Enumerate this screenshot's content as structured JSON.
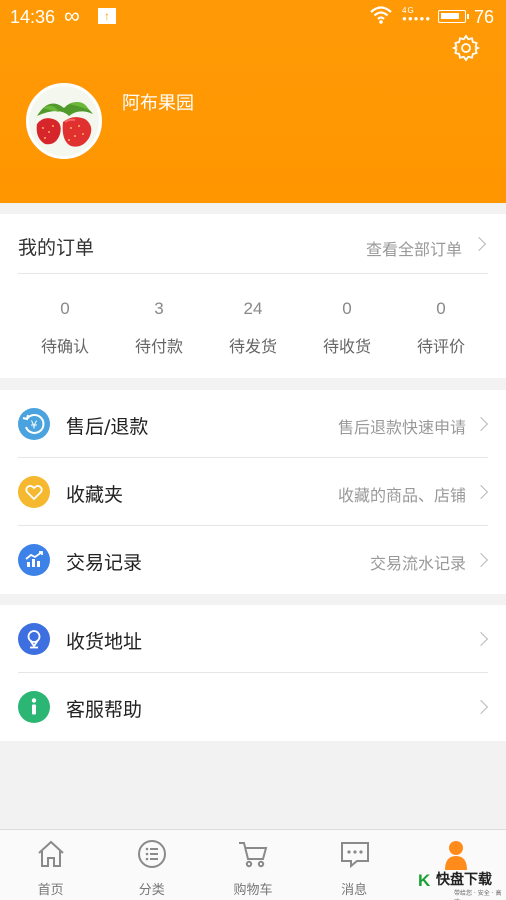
{
  "status_bar": {
    "time": "14:36",
    "infinity": "∞",
    "upload": "↑",
    "signal": "4G",
    "battery": "76"
  },
  "profile": {
    "name": "阿布果园",
    "avatar": "strawberry-avatar"
  },
  "orders": {
    "title": "我的订单",
    "view_all": "查看全部订单",
    "stats": [
      {
        "count": "0",
        "label": "待确认"
      },
      {
        "count": "3",
        "label": "待付款"
      },
      {
        "count": "24",
        "label": "待发货"
      },
      {
        "count": "0",
        "label": "待收货"
      },
      {
        "count": "0",
        "label": "待评价"
      }
    ]
  },
  "menu_group1": [
    {
      "label": "售后/退款",
      "hint": "售后退款快速申请",
      "icon": "refund-icon",
      "color": "#4aa3df"
    },
    {
      "label": "收藏夹",
      "hint": "收藏的商品、店铺",
      "icon": "heart-icon",
      "color": "#f5b82e"
    },
    {
      "label": "交易记录",
      "hint": "交易流水记录",
      "icon": "chart-icon",
      "color": "#3d82e8"
    }
  ],
  "menu_group2": [
    {
      "label": "收货地址",
      "hint": "",
      "icon": "location-icon",
      "color": "#3d6fe0"
    },
    {
      "label": "客服帮助",
      "hint": "",
      "icon": "info-icon",
      "color": "#2bb673"
    }
  ],
  "tabbar": [
    {
      "label": "首页",
      "icon": "home-icon"
    },
    {
      "label": "分类",
      "icon": "list-icon"
    },
    {
      "label": "购物车",
      "icon": "cart-icon"
    },
    {
      "label": "消息",
      "icon": "message-icon"
    },
    {
      "label": "",
      "icon": "profile-icon"
    }
  ],
  "watermark": {
    "k": "K",
    "text": "快盘下载",
    "sub": "带给您 · 安全 · 高速"
  },
  "colors": {
    "accent": "#ff9600",
    "header": "#ff9a06"
  }
}
